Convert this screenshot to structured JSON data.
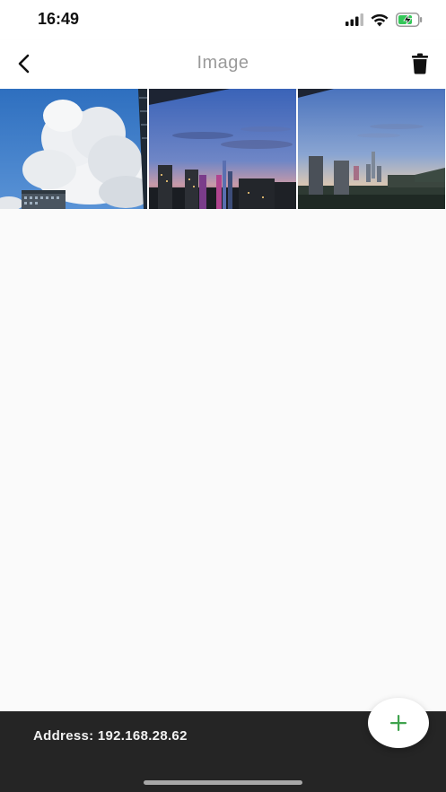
{
  "status_bar": {
    "time": "16:49",
    "icons": [
      "signal-icon",
      "wifi-icon",
      "battery-charging-icon"
    ]
  },
  "nav": {
    "title": "Image",
    "back_icon": "chevron-left-icon",
    "delete_icon": "trash-icon"
  },
  "gallery": {
    "images": [
      {
        "subject": "cloud-sky-photo"
      },
      {
        "subject": "city-dusk-photo"
      },
      {
        "subject": "city-skyline-photo"
      }
    ]
  },
  "footer": {
    "address": "Address: 192.168.28.62"
  },
  "fab": {
    "icon": "plus-icon",
    "accent": "#3fa34d"
  },
  "colors": {
    "bottom_bar": "#252525",
    "title": "#9a9a9a"
  }
}
